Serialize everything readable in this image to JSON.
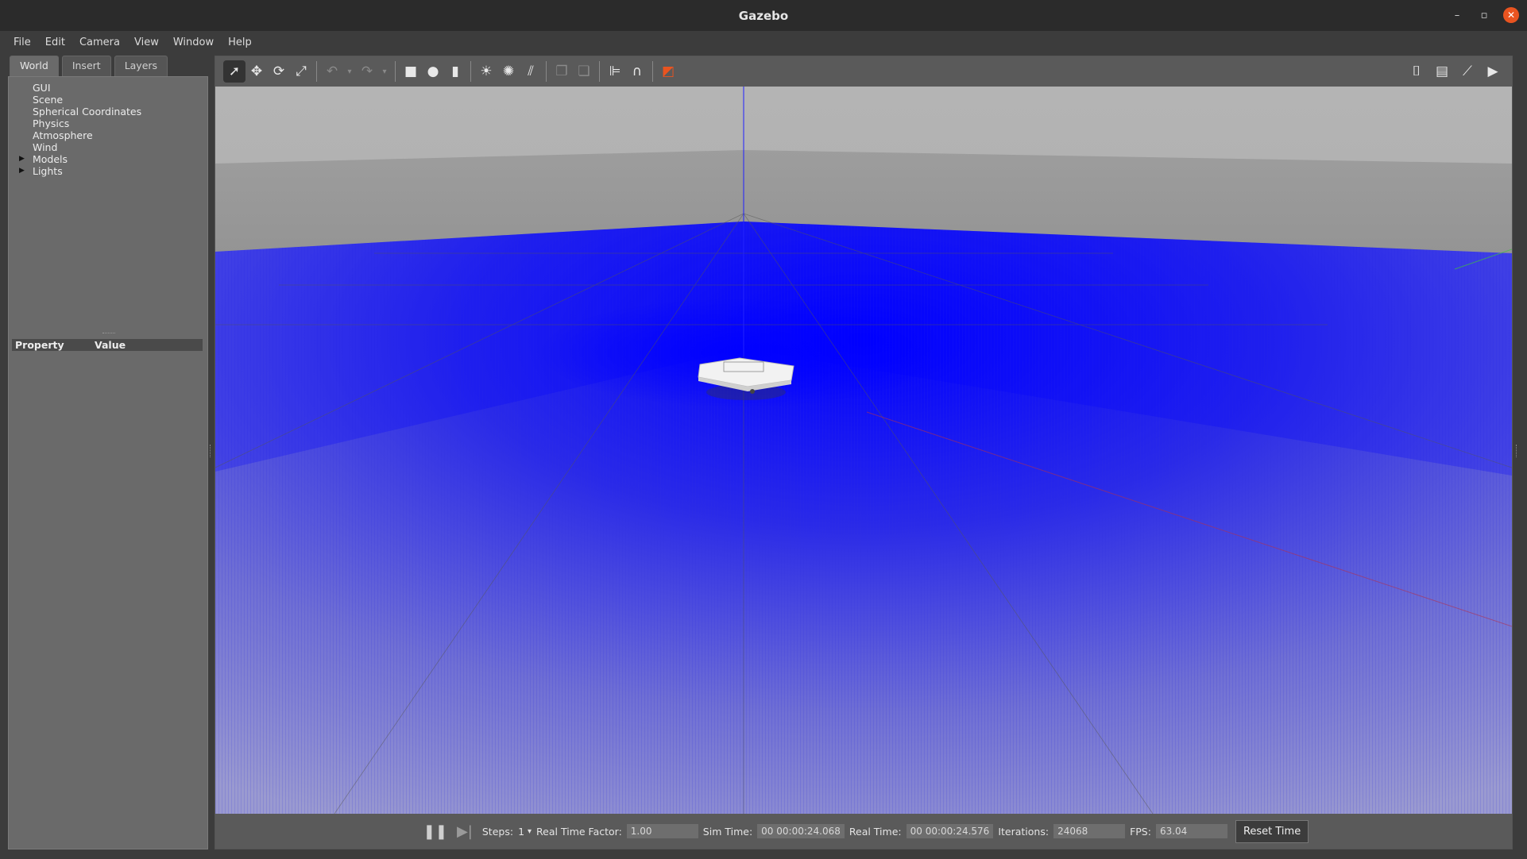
{
  "window": {
    "title": "Gazebo"
  },
  "menu": [
    "File",
    "Edit",
    "Camera",
    "View",
    "Window",
    "Help"
  ],
  "left_panel": {
    "tabs": [
      {
        "label": "World",
        "active": true
      },
      {
        "label": "Insert",
        "active": false
      },
      {
        "label": "Layers",
        "active": false
      }
    ],
    "tree": [
      {
        "label": "GUI",
        "expandable": false
      },
      {
        "label": "Scene",
        "expandable": false
      },
      {
        "label": "Spherical Coordinates",
        "expandable": false
      },
      {
        "label": "Physics",
        "expandable": false
      },
      {
        "label": "Atmosphere",
        "expandable": false
      },
      {
        "label": "Wind",
        "expandable": false
      },
      {
        "label": "Models",
        "expandable": true
      },
      {
        "label": "Lights",
        "expandable": true
      }
    ],
    "property_header": {
      "property": "Property",
      "value": "Value"
    }
  },
  "toolbar": {
    "tools": [
      "select-arrow-icon",
      "translate-icon",
      "rotate-icon",
      "scale-icon",
      "undo-icon",
      "redo-icon",
      "box-icon",
      "sphere-icon",
      "cylinder-icon",
      "point-light-icon",
      "spot-light-icon",
      "directional-light-icon",
      "copy-icon",
      "paste-icon",
      "align-icon",
      "snap-icon",
      "view-angle-icon"
    ],
    "right_tools": [
      "screenshot-icon",
      "log-icon",
      "plot-icon",
      "video-record-icon"
    ]
  },
  "status": {
    "steps_label": "Steps:",
    "steps_value": "1",
    "rtf_label": "Real Time Factor:",
    "rtf_value": "1.00",
    "sim_time_label": "Sim Time:",
    "sim_time_value": "00 00:00:24.068",
    "real_time_label": "Real Time:",
    "real_time_value": "00 00:00:24.576",
    "iterations_label": "Iterations:",
    "iterations_value": "24068",
    "fps_label": "FPS:",
    "fps_value": "63.04",
    "reset_label": "Reset Time"
  },
  "colors": {
    "accent": "#e95420",
    "laser": "#0000ff"
  }
}
